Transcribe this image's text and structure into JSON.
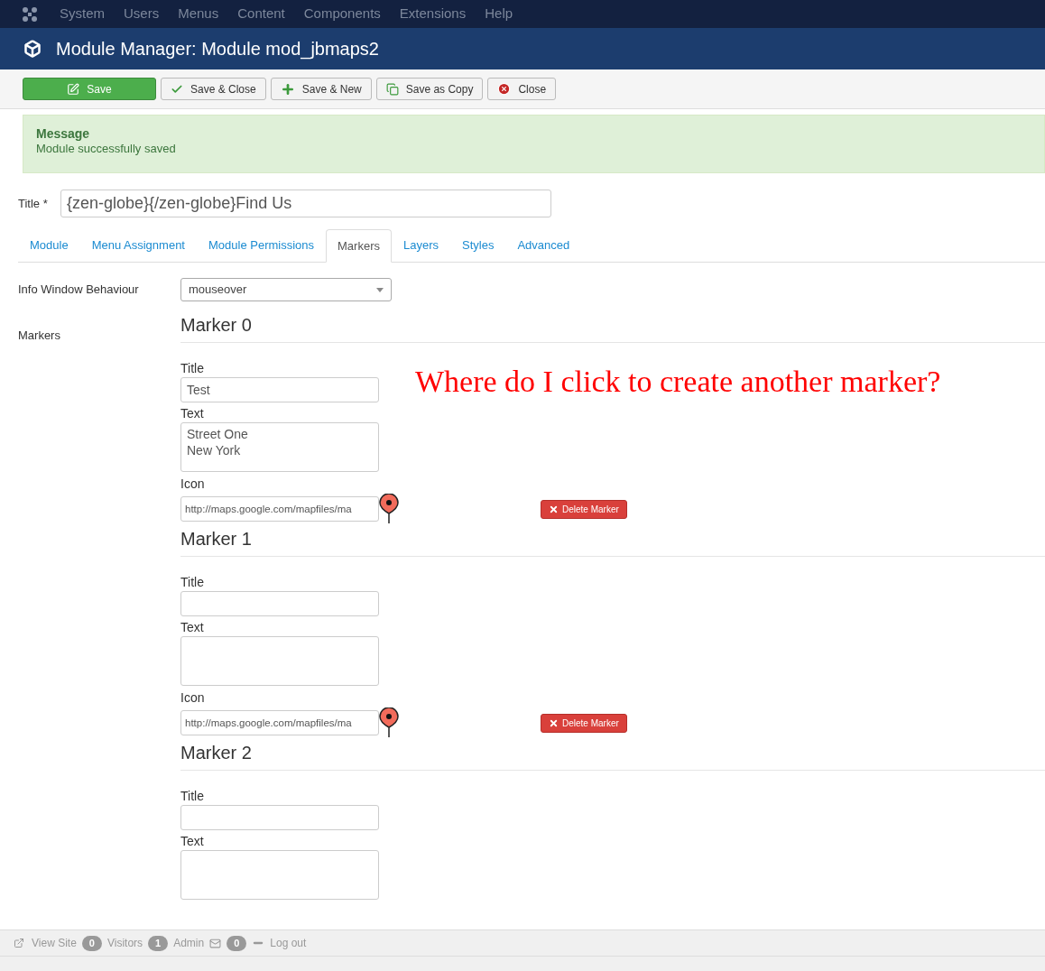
{
  "top_menu": [
    "System",
    "Users",
    "Menus",
    "Content",
    "Components",
    "Extensions",
    "Help"
  ],
  "header": {
    "title": "Module Manager: Module mod_jbmaps2"
  },
  "toolbar": [
    {
      "kind": "save",
      "label": "Save"
    },
    {
      "kind": "check",
      "label": "Save & Close"
    },
    {
      "kind": "plus",
      "label": "Save & New"
    },
    {
      "kind": "copy",
      "label": "Save as Copy"
    },
    {
      "kind": "close",
      "label": "Close"
    }
  ],
  "message": {
    "heading": "Message",
    "text": "Module successfully saved"
  },
  "title_field": {
    "label": "Title *",
    "value": "{zen-globe}{/zen-globe}Find Us"
  },
  "tabs": [
    {
      "label": "Module",
      "selected": false
    },
    {
      "label": "Menu Assignment",
      "selected": false
    },
    {
      "label": "Module Permissions",
      "selected": false
    },
    {
      "label": "Markers",
      "selected": true
    },
    {
      "label": "Layers",
      "selected": false
    },
    {
      "label": "Styles",
      "selected": false
    },
    {
      "label": "Advanced",
      "selected": false
    }
  ],
  "info_window": {
    "label": "Info Window Behaviour",
    "value": "mouseover"
  },
  "markers_label": "Markers",
  "markers": [
    {
      "heading": "Marker 0",
      "title_label": "Title",
      "title": "Test",
      "text_label": "Text",
      "text": [
        "Street One",
        "New York"
      ],
      "icon_label": "Icon",
      "icon": "http://maps.google.com/mapfiles/ma",
      "delete": "Delete Marker"
    },
    {
      "heading": "Marker 1",
      "title_label": "Title",
      "text_label": "Text",
      "icon_label": "Icon",
      "icon": "http://maps.google.com/mapfiles/ma",
      "delete": "Delete Marker"
    },
    {
      "heading": "Marker 2",
      "title_label": "Title",
      "text_label": "Text"
    }
  ],
  "annotation": "Where do I click to create another marker?",
  "status_bar": [
    {
      "kind": "link",
      "label": "View Site"
    },
    {
      "kind": "badge",
      "label": "0"
    },
    {
      "kind": "text",
      "label": "Visitors"
    },
    {
      "kind": "badge",
      "label": "1"
    },
    {
      "kind": "text",
      "label": "Admin"
    },
    {
      "kind": "mail"
    },
    {
      "kind": "badge",
      "label": "0"
    },
    {
      "kind": "dash"
    },
    {
      "kind": "text",
      "label": "Log out"
    }
  ]
}
